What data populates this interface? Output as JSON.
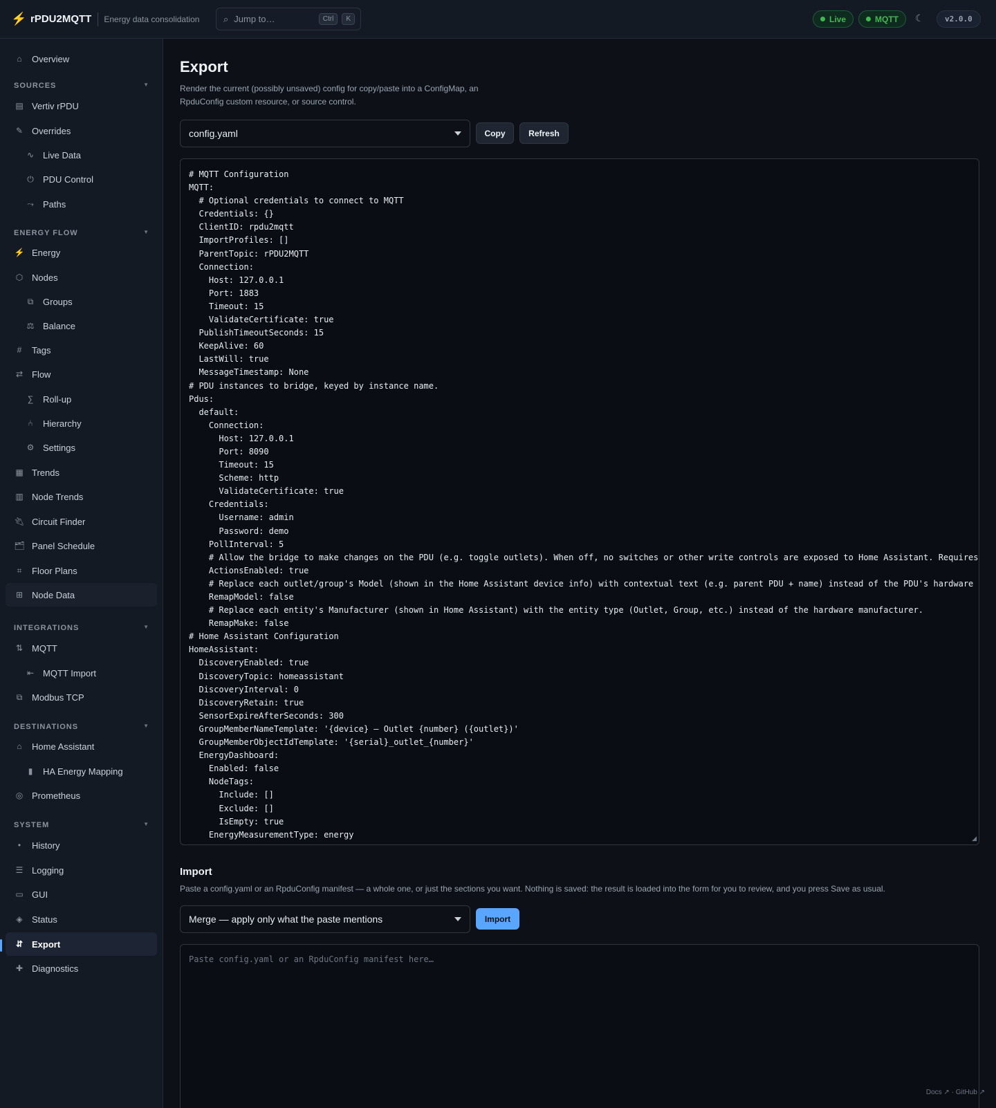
{
  "header": {
    "app_name": "rPDU2MQTT",
    "tagline": "Energy data consolidation",
    "search_placeholder": "Jump to…",
    "kbd_ctrl": "Ctrl",
    "kbd_k": "K",
    "status_live": "Live",
    "status_mqtt": "MQTT",
    "version": "v2.0.0",
    "status_color": "#3fb950"
  },
  "sidebar": {
    "overview": "Overview",
    "sections": {
      "sources": "SOURCES",
      "energy_flow": "ENERGY FLOW",
      "integrations": "INTEGRATIONS",
      "destinations": "DESTINATIONS",
      "system": "SYSTEM"
    },
    "items": {
      "vertiv": "Vertiv rPDU",
      "overrides": "Overrides",
      "live_data": "Live Data",
      "pdu_control": "PDU Control",
      "paths": "Paths",
      "energy": "Energy",
      "nodes": "Nodes",
      "groups": "Groups",
      "balance": "Balance",
      "tags": "Tags",
      "flow": "Flow",
      "rollup": "Roll-up",
      "hierarchy": "Hierarchy",
      "settings": "Settings",
      "trends": "Trends",
      "node_trends": "Node Trends",
      "circuit_finder": "Circuit Finder",
      "panel_schedule": "Panel Schedule",
      "floor_plans": "Floor Plans",
      "node_data": "Node Data",
      "mqtt": "MQTT",
      "mqtt_import": "MQTT Import",
      "modbus_tcp": "Modbus TCP",
      "home_assistant": "Home Assistant",
      "ha_energy_mapping": "HA Energy Mapping",
      "prometheus": "Prometheus",
      "history": "History",
      "logging": "Logging",
      "gui": "GUI",
      "status": "Status",
      "export": "Export",
      "diagnostics": "Diagnostics"
    },
    "accent_color": "#58a6ff"
  },
  "export": {
    "title": "Export",
    "description": "Render the current (possibly unsaved) config for copy/paste into a ConfigMap, an RpduConfig custom resource, or source control.",
    "format_selected": "config.yaml",
    "copy_label": "Copy",
    "refresh_label": "Refresh",
    "yaml_lines": [
      "# MQTT Configuration",
      "MQTT:",
      "  # Optional credentials to connect to MQTT",
      "  Credentials: {}",
      "  ClientID: rpdu2mqtt",
      "  ImportProfiles: []",
      "  ParentTopic: rPDU2MQTT",
      "  Connection:",
      "    Host: 127.0.0.1",
      "    Port: 1883",
      "    Timeout: 15",
      "    ValidateCertificate: true",
      "  PublishTimeoutSeconds: 15",
      "  KeepAlive: 60",
      "  LastWill: true",
      "  MessageTimestamp: None",
      "# PDU instances to bridge, keyed by instance name.",
      "Pdus:",
      "  default:",
      "    Connection:",
      "      Host: 127.0.0.1",
      "      Port: 8090",
      "      Timeout: 15",
      "      Scheme: http",
      "      ValidateCertificate: true",
      "    Credentials:",
      "      Username: admin",
      "      Password: demo",
      "    PollInterval: 5",
      "    # Allow the bridge to make changes on the PDU (e.g. toggle outlets). When off, no switches or other write controls are exposed to Home Assistant. Requires",
      "    ActionsEnabled: true",
      "    # Replace each outlet/group's Model (shown in the Home Assistant device info) with contextual text (e.g. parent PDU + name) instead of the PDU's hardware",
      "    RemapModel: false",
      "    # Replace each entity's Manufacturer (shown in Home Assistant) with the entity type (Outlet, Group, etc.) instead of the hardware manufacturer.",
      "    RemapMake: false",
      "# Home Assistant Configuration",
      "HomeAssistant:",
      "  DiscoveryEnabled: true",
      "  DiscoveryTopic: homeassistant",
      "  DiscoveryInterval: 0",
      "  DiscoveryRetain: true",
      "  SensorExpireAfterSeconds: 300",
      "  GroupMemberNameTemplate: '{device} — Outlet {number} ({outlet})'",
      "  GroupMemberObjectIdTemplate: '{serial}_outlet_{number}'",
      "  EnergyDashboard:",
      "    Enabled: false",
      "    NodeTags:",
      "      Include: []",
      "      Exclude: []",
      "      IsEmpty: true",
      "    EnergyMeasurementType: energy"
    ]
  },
  "import": {
    "title": "Import",
    "description": "Paste a config.yaml or an RpduConfig manifest — a whole one, or just the sections you want. Nothing is saved: the result is loaded into the form for you to review, and you press Save as usual.",
    "mode_selected": "Merge — apply only what the paste mentions",
    "import_label": "Import",
    "paste_placeholder": "Paste config.yaml or an RpduConfig manifest here…"
  },
  "footer": {
    "docs": "Docs ↗",
    "sep": "·",
    "github": "GitHub ↗"
  }
}
